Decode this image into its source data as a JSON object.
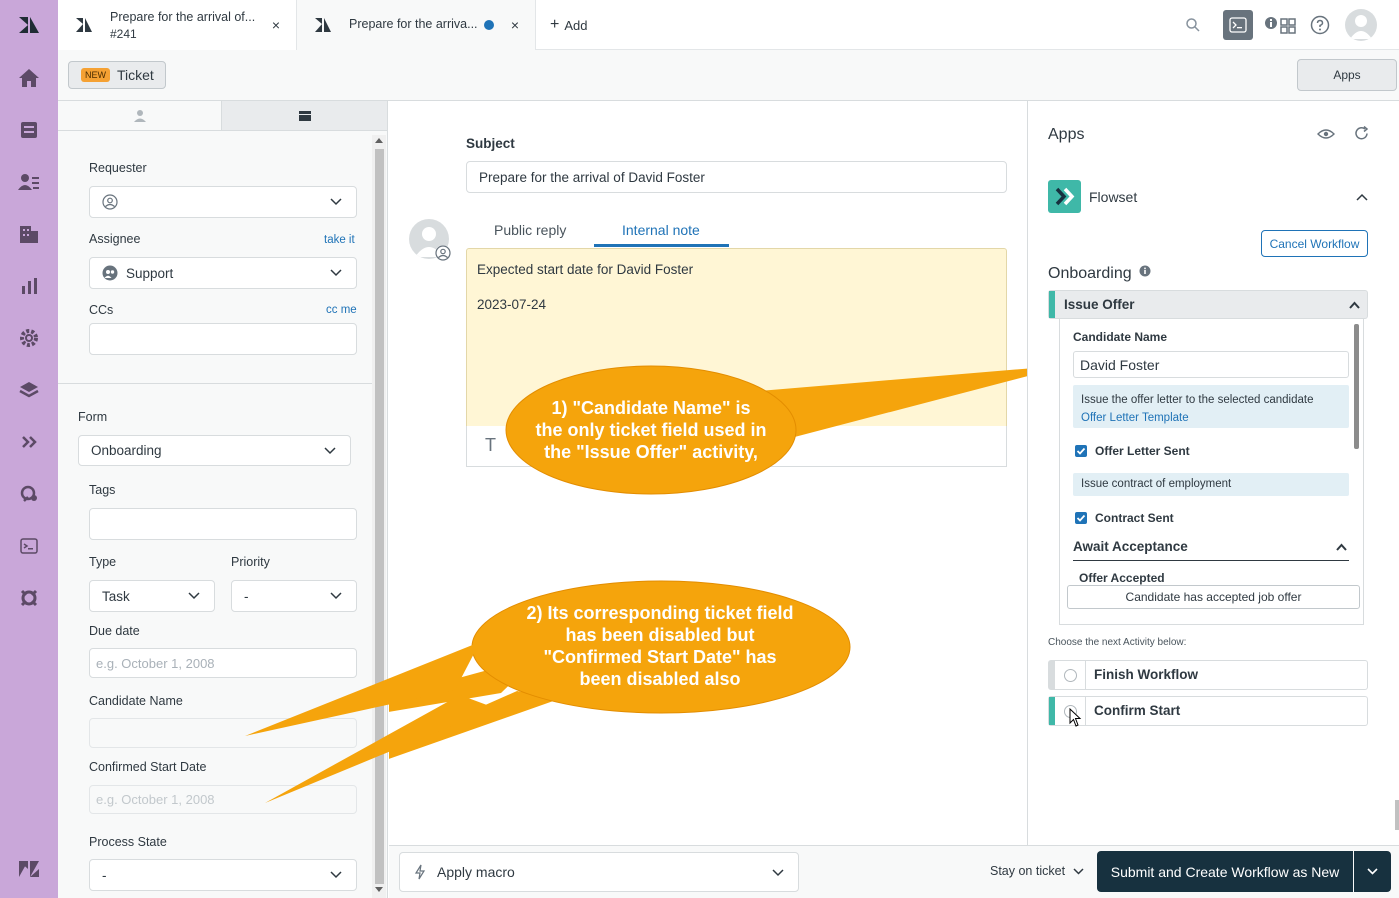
{
  "tabs": [
    {
      "title": "Prepare for the arrival of...",
      "subtitle": "#241",
      "close": "×"
    },
    {
      "title": "Prepare for the arriva...",
      "close": "×"
    }
  ],
  "add_tab_label": "Add",
  "subheader": {
    "badge": "NEW",
    "ticket_label": "Ticket",
    "apps_label": "Apps"
  },
  "properties": {
    "requester_label": "Requester",
    "assignee_label": "Assignee",
    "take_it": "take it",
    "assignee_value": "Support",
    "ccs_label": "CCs",
    "cc_me": "cc me",
    "form_label": "Form",
    "form_value": "Onboarding",
    "tags_label": "Tags",
    "type_label": "Type",
    "type_value": "Task",
    "priority_label": "Priority",
    "priority_value": "-",
    "due_label": "Due date",
    "due_placeholder": "e.g. October 1, 2008",
    "candidate_label": "Candidate Name",
    "confirmed_label": "Confirmed Start Date",
    "confirmed_placeholder": "e.g. October 1, 2008",
    "process_label": "Process State",
    "process_value": "-"
  },
  "editor": {
    "subject_label": "Subject",
    "subject_value": "Prepare for the arrival of David Foster",
    "tab_public": "Public reply",
    "tab_internal": "Internal note",
    "note_line1": "Expected start date for David Foster",
    "note_line2": "2023-07-24"
  },
  "callouts": {
    "one": [
      "1) \"Candidate Name\" is",
      "the only ticket field used in",
      "the \"Issue Offer\" activity,"
    ],
    "two": [
      "2) Its corresponding ticket field",
      "has been disabled but",
      "\"Confirmed Start Date\" has",
      "been disabled also"
    ]
  },
  "apps": {
    "title": "Apps",
    "app_name": "Flowset",
    "cancel_workflow": "Cancel Workflow",
    "workflow_name": "Onboarding",
    "activity_name": "Issue Offer",
    "candidate_name_label": "Candidate Name",
    "candidate_name_value": "David Foster",
    "offer_info": "Issue the offer letter to the selected candidate",
    "offer_template_link": "Offer Letter Template",
    "offer_letter_sent": "Offer Letter Sent",
    "contract_info": "Issue contract of employment",
    "contract_sent": "Contract Sent",
    "await_acceptance": "Await Acceptance",
    "offer_accepted_label": "Offer Accepted",
    "offer_accepted_button": "Candidate has accepted job offer",
    "next_activity_prompt": "Choose the next Activity below:",
    "next_activities": [
      "Finish Workflow",
      "Confirm Start"
    ]
  },
  "bottom": {
    "apply_macro": "Apply macro",
    "stay_on_ticket": "Stay on ticket",
    "submit_label": "Submit and Create Workflow as New"
  },
  "colors": {
    "nav_bg": "#c9a7d9",
    "callout": "#f5a40c",
    "teal": "#3fb8a8",
    "link": "#1f73b7",
    "note_bg": "#fff6d5",
    "submit_bg": "#17313f"
  }
}
